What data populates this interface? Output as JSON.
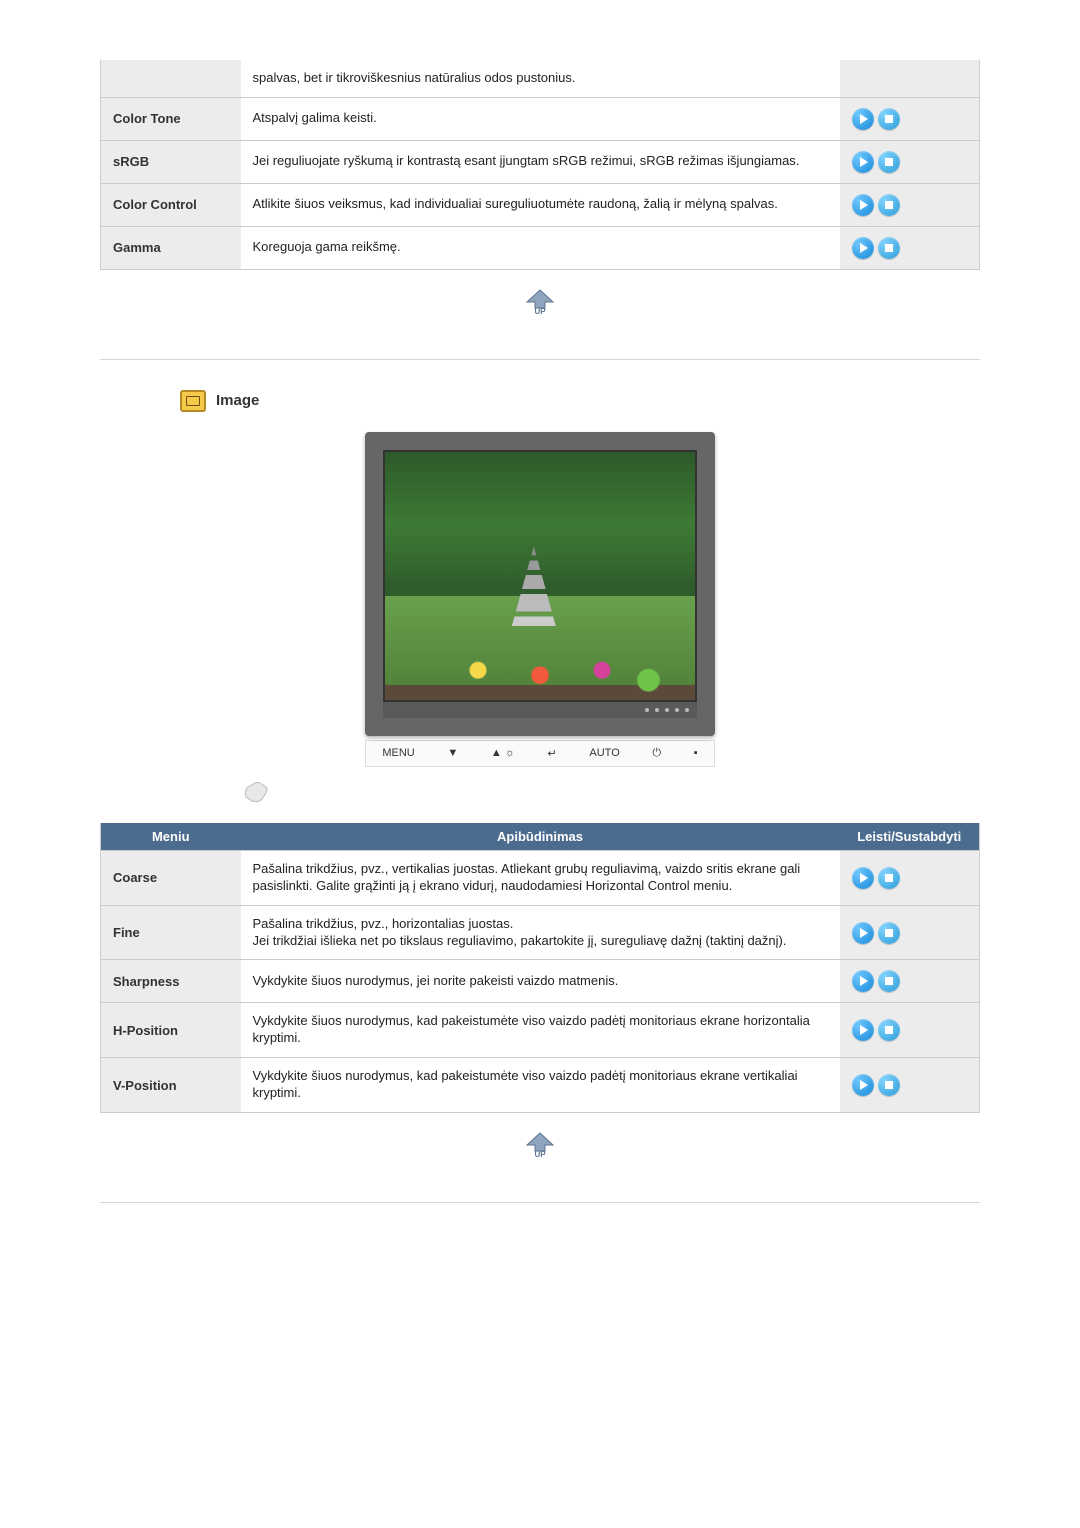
{
  "table1": {
    "rows": [
      {
        "name": "",
        "desc": "spalvas, bet ir tikroviškesnius natūralius odos pustonius.",
        "name_bg": true,
        "has_buttons": false
      },
      {
        "name": "Color Tone",
        "desc": "Atspalvį galima keisti.",
        "has_buttons": true
      },
      {
        "name": "sRGB",
        "desc": "Jei reguliuojate ryškumą ir kontrastą esant įjungtam sRGB režimui, sRGB režimas išjungiamas.",
        "has_buttons": true
      },
      {
        "name": "Color Control",
        "desc": "Atlikite šiuos veiksmus, kad individualiai sureguliuotumėte raudoną, žalią ir mėlyną spalvas.",
        "has_buttons": true
      },
      {
        "name": "Gamma",
        "desc": "Koreguoja gama reikšmę.",
        "has_buttons": true
      }
    ]
  },
  "section2": {
    "title": "Image"
  },
  "monitor_controls": {
    "items": [
      "MENU",
      "▼",
      "▲ ☼",
      "↵",
      "AUTO",
      "⏻",
      "▪"
    ]
  },
  "table2": {
    "headers": {
      "c1": "Meniu",
      "c2": "Apibūdinimas",
      "c3": "Leisti/Sustabdyti"
    },
    "rows": [
      {
        "name": "Coarse",
        "desc": "Pašalina trikdžius, pvz., vertikalias juostas. Atliekant grubų reguliavimą, vaizdo sritis ekrane gali pasislinkti. Galite grąžinti ją į ekrano vidurį, naudodamiesi Horizontal Control meniu."
      },
      {
        "name": "Fine",
        "desc": "Pašalina trikdžius, pvz., horizontalias juostas.\nJei trikdžiai išlieka net po tikslaus reguliavimo, pakartokite jį, sureguliavę dažnį (taktinį dažnį)."
      },
      {
        "name": "Sharpness",
        "desc": "Vykdykite šiuos nurodymus, jei norite pakeisti vaizdo matmenis."
      },
      {
        "name": "H-Position",
        "desc": "Vykdykite šiuos nurodymus, kad pakeistumėte viso vaizdo padėtį monitoriaus ekrane horizontalia kryptimi."
      },
      {
        "name": "V-Position",
        "desc": "Vykdykite šiuos nurodymus, kad pakeistumėte viso vaizdo padėtį monitoriaus ekrane vertikaliai kryptimi."
      }
    ]
  }
}
